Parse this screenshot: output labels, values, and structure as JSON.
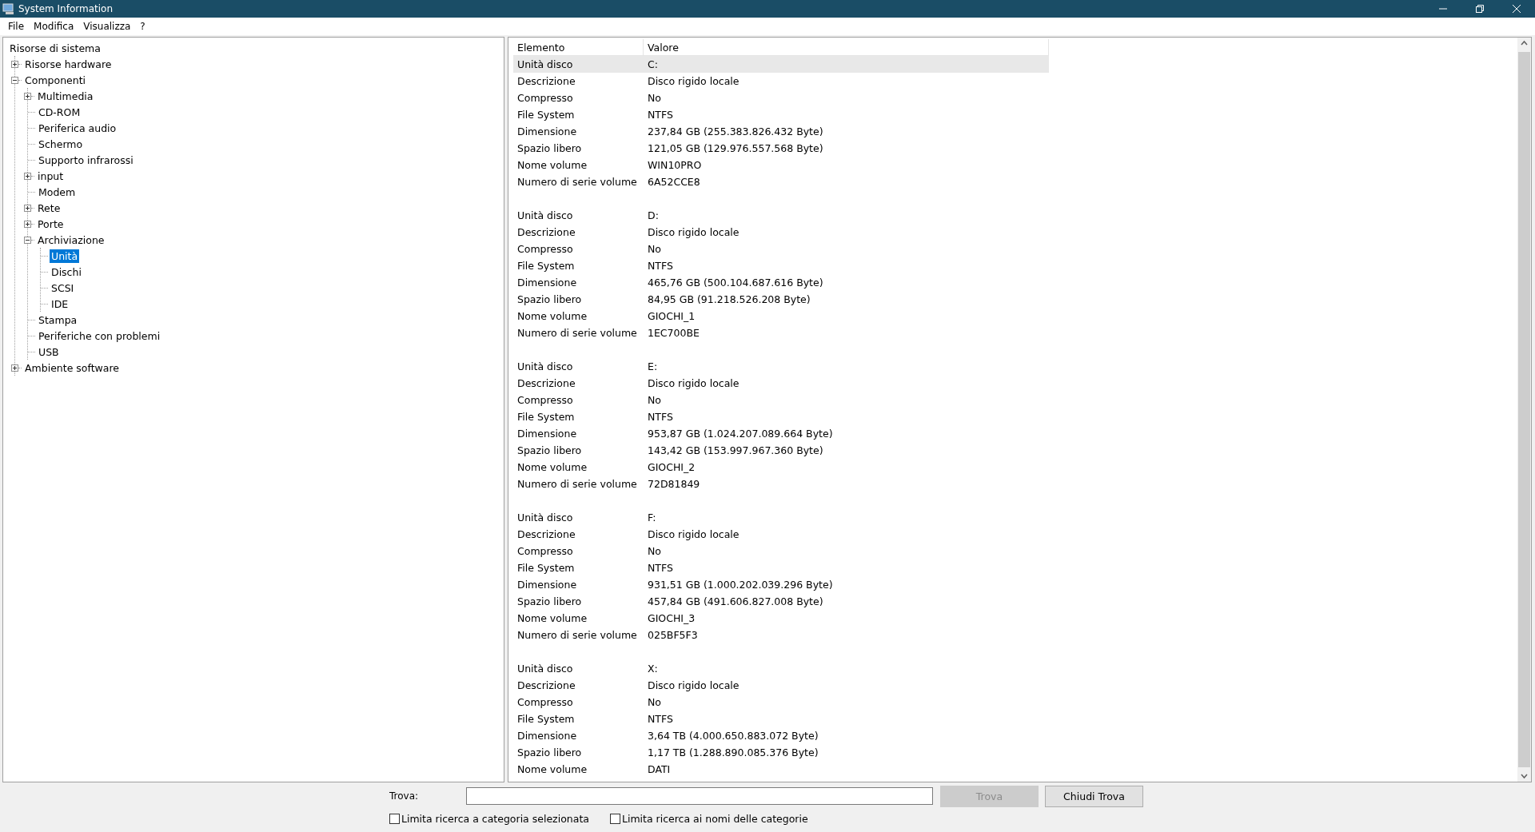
{
  "window": {
    "title": "System Information"
  },
  "menu": [
    "File",
    "Modifica",
    "Visualizza",
    "?"
  ],
  "tree": {
    "label": "Risorse di sistema",
    "selected": false,
    "children": [
      {
        "label": "Risorse hardware",
        "expanded": false,
        "selected": false
      },
      {
        "label": "Componenti",
        "expanded": true,
        "selected": false,
        "children": [
          {
            "label": "Multimedia",
            "expanded": false,
            "selected": false
          },
          {
            "label": "CD-ROM",
            "selected": false
          },
          {
            "label": "Periferica audio",
            "selected": false
          },
          {
            "label": "Schermo",
            "selected": false
          },
          {
            "label": "Supporto infrarossi",
            "selected": false
          },
          {
            "label": "input",
            "expanded": false,
            "selected": false
          },
          {
            "label": "Modem",
            "selected": false
          },
          {
            "label": "Rete",
            "expanded": false,
            "selected": false
          },
          {
            "label": "Porte",
            "expanded": false,
            "selected": false
          },
          {
            "label": "Archiviazione",
            "expanded": true,
            "selected": false,
            "children": [
              {
                "label": "Unità",
                "selected": true
              },
              {
                "label": "Dischi",
                "selected": false
              },
              {
                "label": "SCSI",
                "selected": false
              },
              {
                "label": "IDE",
                "selected": false
              }
            ]
          },
          {
            "label": "Stampa",
            "selected": false
          },
          {
            "label": "Periferiche con problemi",
            "selected": false
          },
          {
            "label": "USB",
            "selected": false
          }
        ]
      },
      {
        "label": "Ambiente software",
        "expanded": false,
        "selected": false
      }
    ]
  },
  "table": {
    "columns": [
      "Elemento",
      "Valore"
    ],
    "groups": [
      {
        "rows": [
          {
            "element": "Unità disco",
            "value": "C:",
            "selected": true
          },
          {
            "element": "Descrizione",
            "value": "Disco rigido locale",
            "selected": false
          },
          {
            "element": "Compresso",
            "value": "No",
            "selected": false
          },
          {
            "element": "File System",
            "value": "NTFS",
            "selected": false
          },
          {
            "element": "Dimensione",
            "value": "237,84 GB (255.383.826.432 Byte)",
            "selected": false
          },
          {
            "element": "Spazio libero",
            "value": "121,05 GB (129.976.557.568 Byte)",
            "selected": false
          },
          {
            "element": "Nome volume",
            "value": "WIN10PRO",
            "selected": false
          },
          {
            "element": "Numero di serie volume",
            "value": "6A52CCE8",
            "selected": false
          }
        ]
      },
      {
        "rows": [
          {
            "element": "Unità disco",
            "value": "D:",
            "selected": false
          },
          {
            "element": "Descrizione",
            "value": "Disco rigido locale",
            "selected": false
          },
          {
            "element": "Compresso",
            "value": "No",
            "selected": false
          },
          {
            "element": "File System",
            "value": "NTFS",
            "selected": false
          },
          {
            "element": "Dimensione",
            "value": "465,76 GB (500.104.687.616 Byte)",
            "selected": false
          },
          {
            "element": "Spazio libero",
            "value": "84,95 GB (91.218.526.208 Byte)",
            "selected": false
          },
          {
            "element": "Nome volume",
            "value": "GIOCHI_1",
            "selected": false
          },
          {
            "element": "Numero di serie volume",
            "value": "1EC700BE",
            "selected": false
          }
        ]
      },
      {
        "rows": [
          {
            "element": "Unità disco",
            "value": "E:",
            "selected": false
          },
          {
            "element": "Descrizione",
            "value": "Disco rigido locale",
            "selected": false
          },
          {
            "element": "Compresso",
            "value": "No",
            "selected": false
          },
          {
            "element": "File System",
            "value": "NTFS",
            "selected": false
          },
          {
            "element": "Dimensione",
            "value": "953,87 GB (1.024.207.089.664 Byte)",
            "selected": false
          },
          {
            "element": "Spazio libero",
            "value": "143,42 GB (153.997.967.360 Byte)",
            "selected": false
          },
          {
            "element": "Nome volume",
            "value": "GIOCHI_2",
            "selected": false
          },
          {
            "element": "Numero di serie volume",
            "value": "72D81849",
            "selected": false
          }
        ]
      },
      {
        "rows": [
          {
            "element": "Unità disco",
            "value": "F:",
            "selected": false
          },
          {
            "element": "Descrizione",
            "value": "Disco rigido locale",
            "selected": false
          },
          {
            "element": "Compresso",
            "value": "No",
            "selected": false
          },
          {
            "element": "File System",
            "value": "NTFS",
            "selected": false
          },
          {
            "element": "Dimensione",
            "value": "931,51 GB (1.000.202.039.296 Byte)",
            "selected": false
          },
          {
            "element": "Spazio libero",
            "value": "457,84 GB (491.606.827.008 Byte)",
            "selected": false
          },
          {
            "element": "Nome volume",
            "value": "GIOCHI_3",
            "selected": false
          },
          {
            "element": "Numero di serie volume",
            "value": "025BF5F3",
            "selected": false
          }
        ]
      },
      {
        "rows": [
          {
            "element": "Unità disco",
            "value": "X:",
            "selected": false
          },
          {
            "element": "Descrizione",
            "value": "Disco rigido locale",
            "selected": false
          },
          {
            "element": "Compresso",
            "value": "No",
            "selected": false
          },
          {
            "element": "File System",
            "value": "NTFS",
            "selected": false
          },
          {
            "element": "Dimensione",
            "value": "3,64 TB (4.000.650.883.072 Byte)",
            "selected": false
          },
          {
            "element": "Spazio libero",
            "value": "1,17 TB (1.288.890.085.376 Byte)",
            "selected": false
          },
          {
            "element": "Nome volume",
            "value": "DATI",
            "selected": false
          }
        ]
      }
    ]
  },
  "find": {
    "label": "Trova:",
    "find_button": {
      "label": "Trova",
      "disabled": true
    },
    "close_button": {
      "label": "Chiudi Trova",
      "disabled": false
    },
    "options": [
      {
        "label": "Limita ricerca a categoria selezionata",
        "checked": false
      },
      {
        "label": "Limita ricerca ai nomi delle categorie",
        "checked": false
      }
    ]
  }
}
